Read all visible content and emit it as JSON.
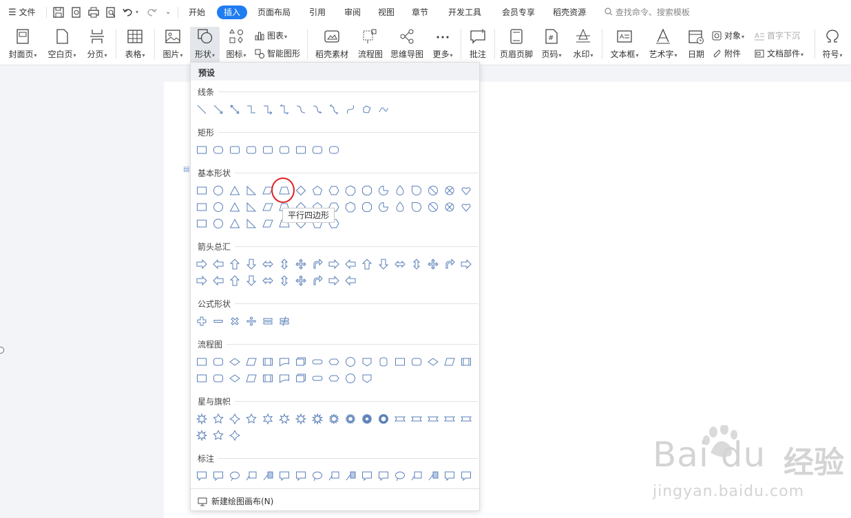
{
  "menubar": {
    "file_label": "文件",
    "tabs": [
      "开始",
      "插入",
      "页面布局",
      "引用",
      "审阅",
      "视图",
      "章节",
      "开发工具",
      "会员专享",
      "稻壳资源"
    ],
    "search_placeholder": "查找命令、搜索模板"
  },
  "ribbon": {
    "cover_page": "封面页",
    "blank_page": "空白页",
    "page_break": "分页",
    "table": "表格",
    "picture": "图片",
    "shape": "形状",
    "icon": "图标",
    "chart": "图表",
    "smart_shape": "智能图形",
    "daoke_material": "稻壳素材",
    "flowchart": "流程图",
    "mindmap": "思维导图",
    "more": "更多",
    "comment": "批注",
    "header_footer": "页眉页脚",
    "page_number": "页码",
    "watermark": "水印",
    "text_box": "文本框",
    "word_art": "艺术字",
    "date": "日期",
    "object": "对象",
    "drop_cap": "首字下沉",
    "attachment": "附件",
    "doc_part": "文档部件",
    "symbol": "符号"
  },
  "dropdown": {
    "preset": "预设",
    "sections": {
      "lines": "线条",
      "rectangles": "矩形",
      "basic": "基本形状",
      "arrows": "箭头总汇",
      "formula": "公式形状",
      "flowchart": "流程图",
      "stars": "星与旗帜",
      "callouts": "标注"
    },
    "new_canvas": "新建绘图画布(N)"
  },
  "tooltip": "平行四边形",
  "watermark": {
    "logo": "Bai du",
    "cn": "经验",
    "url": "jingyan.baidu.com"
  },
  "colors": {
    "accent": "#1e7df0",
    "shape_stroke": "#5a7fb8",
    "highlight": "#e02020"
  }
}
